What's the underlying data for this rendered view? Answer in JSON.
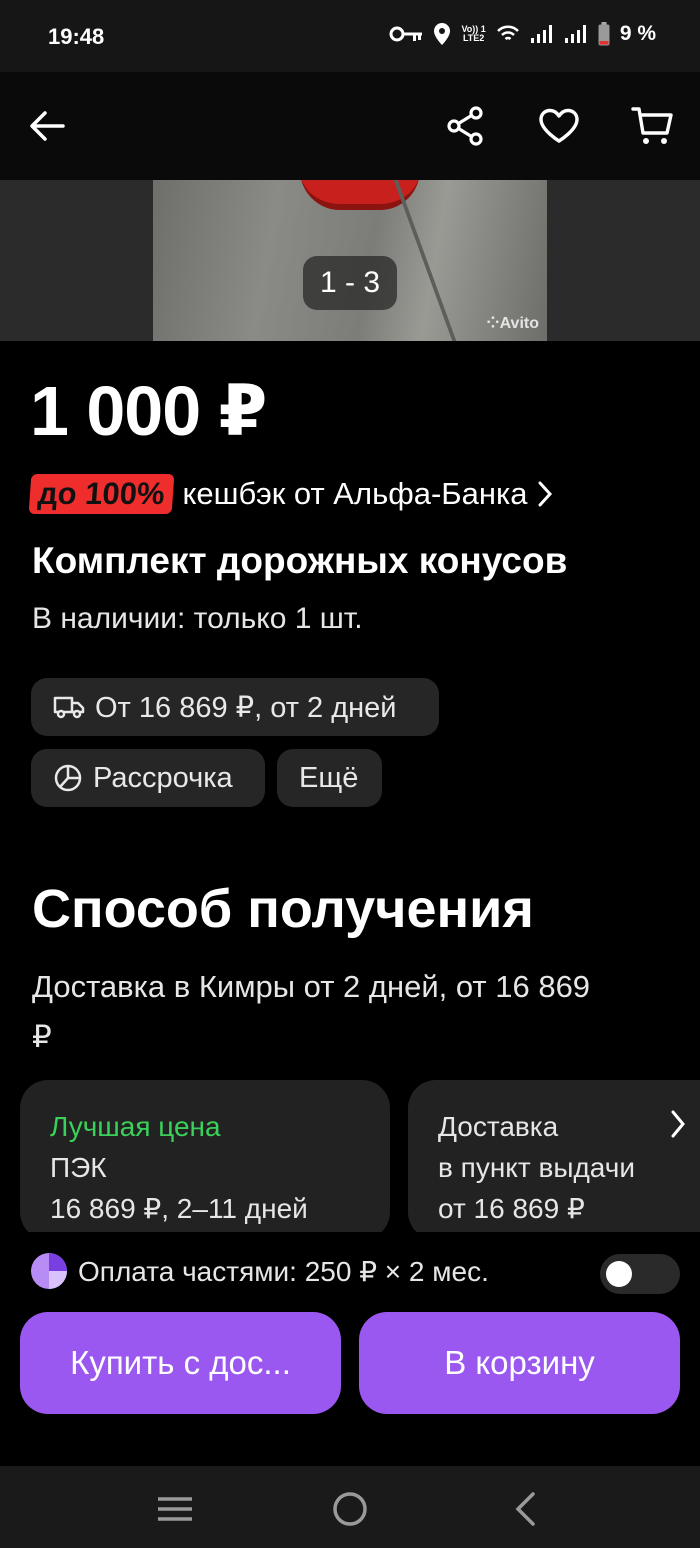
{
  "status_bar": {
    "time": "19:48",
    "volte_label": "Vo)) 1",
    "lte_label": "LTE2",
    "battery": "9 %"
  },
  "app_bar": {
    "icons": [
      "back-arrow-icon",
      "share-icon",
      "favorite-heart-icon",
      "cart-icon"
    ]
  },
  "gallery": {
    "counter": "1 - 3",
    "watermark": "Avito"
  },
  "product": {
    "price": "1 000 ₽",
    "cashback_badge": "до 100%",
    "cashback_text": "кешбэк от Альфа-Банка",
    "title": "Комплект дорожных конусов",
    "stock": "В наличии: только 1 шт."
  },
  "chips": {
    "delivery": "От 16 869 ₽, от 2 дней",
    "installment": "Рассрочка",
    "more": "Ещё"
  },
  "receiving": {
    "title": "Способ получения",
    "delivery_summary": "Доставка в Кимры от 2 дней, от 16 869 ₽",
    "options": [
      {
        "tag": "Лучшая цена",
        "name": "ПЭК",
        "details": "16 869 ₽, 2–11 дней"
      },
      {
        "line1": "Доставка",
        "line2": "в пункт выдачи",
        "line3": "от 16 869 ₽"
      }
    ]
  },
  "bottom": {
    "installments_text": "Оплата частями: 250 ₽ × 2 мес.",
    "installments_enabled": false,
    "buy_button": "Купить с дос...",
    "cart_button": "В корзину"
  },
  "colors": {
    "accent_purple": "#9b58f0",
    "best_price_green": "#3ad15b",
    "cashback_red": "#f02d2d"
  }
}
